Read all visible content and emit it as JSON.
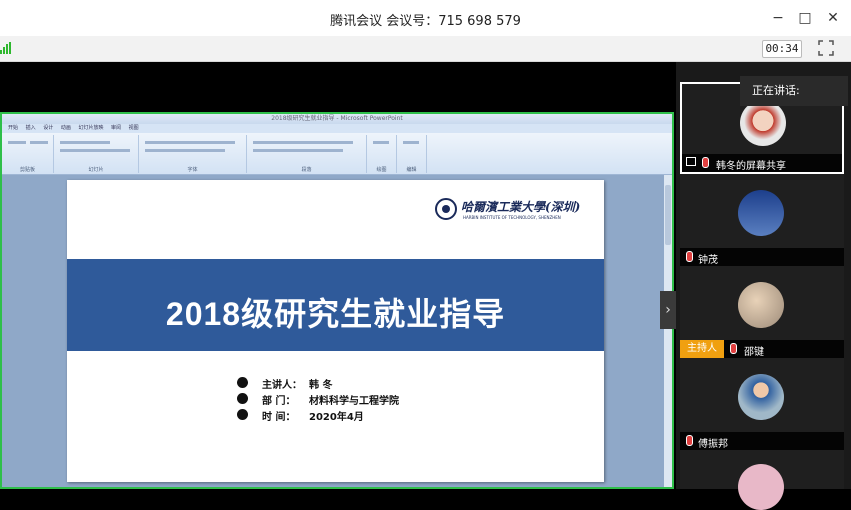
{
  "window": {
    "title": "腾讯会议  会议号：715 698 579",
    "minimize_glyph": "−",
    "maximize_glyph": "□",
    "close_glyph": "✕"
  },
  "toolbar": {
    "timer": "00:34",
    "signal_icon": "signal-strength-icon",
    "fullscreen_icon": "fullscreen-icon"
  },
  "powerpoint": {
    "window_title": "2018级研究生就业指导 - Microsoft PowerPoint",
    "menu": [
      "开始",
      "插入",
      "设计",
      "动画",
      "幻灯片放映",
      "审阅",
      "视图"
    ],
    "ribbon_groups": [
      "剪贴板",
      "幻灯片",
      "字体",
      "段落",
      "绘图",
      "编辑"
    ]
  },
  "slide": {
    "logo_cn": "哈爾濱工業大學(深圳)",
    "logo_en": "HARBIN INSTITUTE OF TECHNOLOGY, SHENZHEN",
    "title": "2018级研究生就业指导",
    "info": [
      {
        "icon": "microphone-icon",
        "label": "主讲人：",
        "value": "韩  冬"
      },
      {
        "icon": "compass-icon",
        "label": "部    门：",
        "value": "材料科学与工程学院"
      },
      {
        "icon": "home-icon",
        "label": "时    间：",
        "value": "2020年4月"
      }
    ]
  },
  "sidebar": {
    "speaking_label": "正在讲话:",
    "collapse_glyph": "›",
    "participants": [
      {
        "name": "韩冬的屏幕共享",
        "host": false,
        "sharing": true
      },
      {
        "name": "钟茂",
        "host": false,
        "sharing": false
      },
      {
        "name": "邵键",
        "host": true,
        "host_label": "主持人",
        "sharing": false
      },
      {
        "name": "傅振邦",
        "host": false,
        "sharing": false
      }
    ]
  },
  "colors": {
    "banner": "#2f5a9a",
    "share_border": "#2fbf4a",
    "host_badge": "#f0a010",
    "mic_muted": "#e04040"
  }
}
